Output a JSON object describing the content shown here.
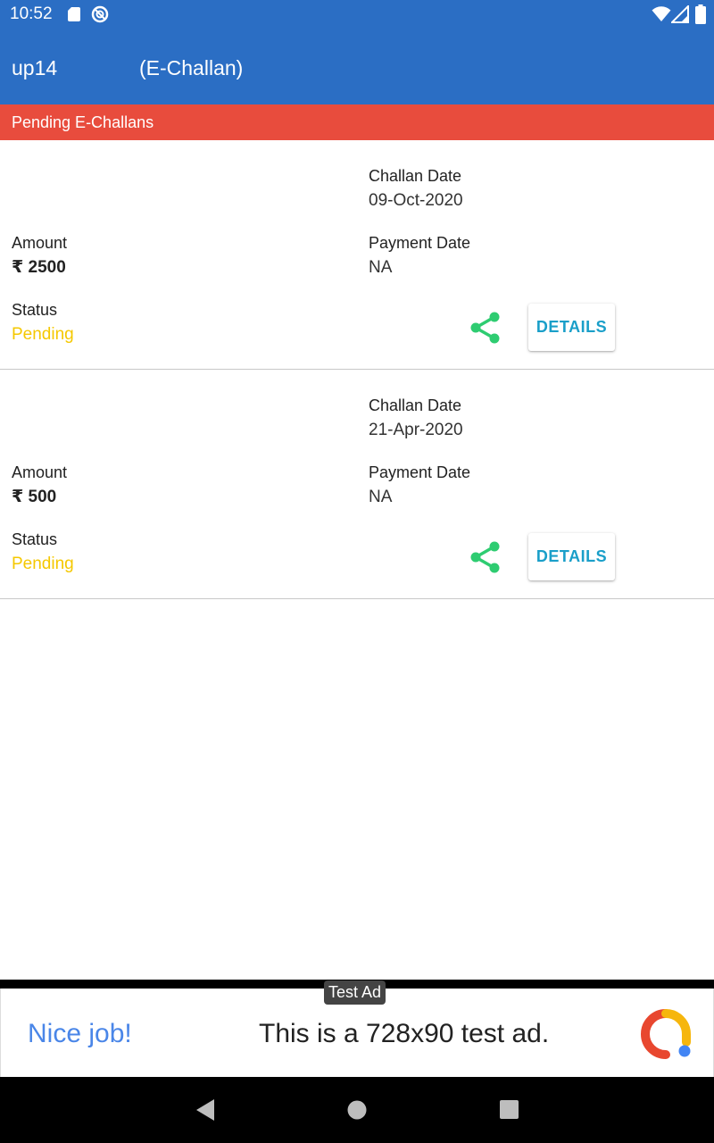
{
  "status_bar": {
    "time": "10:52",
    "icons": [
      "sd-card-icon",
      "circle-status-icon",
      "wifi-icon",
      "signal-icon",
      "battery-icon"
    ]
  },
  "app_bar": {
    "title": "up14",
    "subtitle": "(E-Challan)",
    "color": "#2b6ec4"
  },
  "section": {
    "title": "Pending E-Challans",
    "color": "#e84c3d"
  },
  "challans": [
    {
      "challan_date_label": "Challan Date",
      "challan_date": "09-Oct-2020",
      "amount_label": "Amount",
      "amount": "₹ 2500",
      "payment_date_label": "Payment Date",
      "payment_date": "NA",
      "status_label": "Status",
      "status": "Pending",
      "details_label": "DETAILS"
    },
    {
      "challan_date_label": "Challan Date",
      "challan_date": "21-Apr-2020",
      "amount_label": "Amount",
      "amount": "₹ 500",
      "payment_date_label": "Payment Date",
      "payment_date": "NA",
      "status_label": "Status",
      "status": "Pending",
      "details_label": "DETAILS"
    }
  ],
  "colors": {
    "pending": "#f5c800",
    "share": "#2ecc71",
    "details_text": "#1a9fc9"
  },
  "ad": {
    "tag": "Test Ad",
    "headline": "Nice job!",
    "body": "This is a 728x90 test ad."
  },
  "nav_bar": {
    "icons": [
      "back-icon",
      "home-icon",
      "recents-icon"
    ]
  }
}
